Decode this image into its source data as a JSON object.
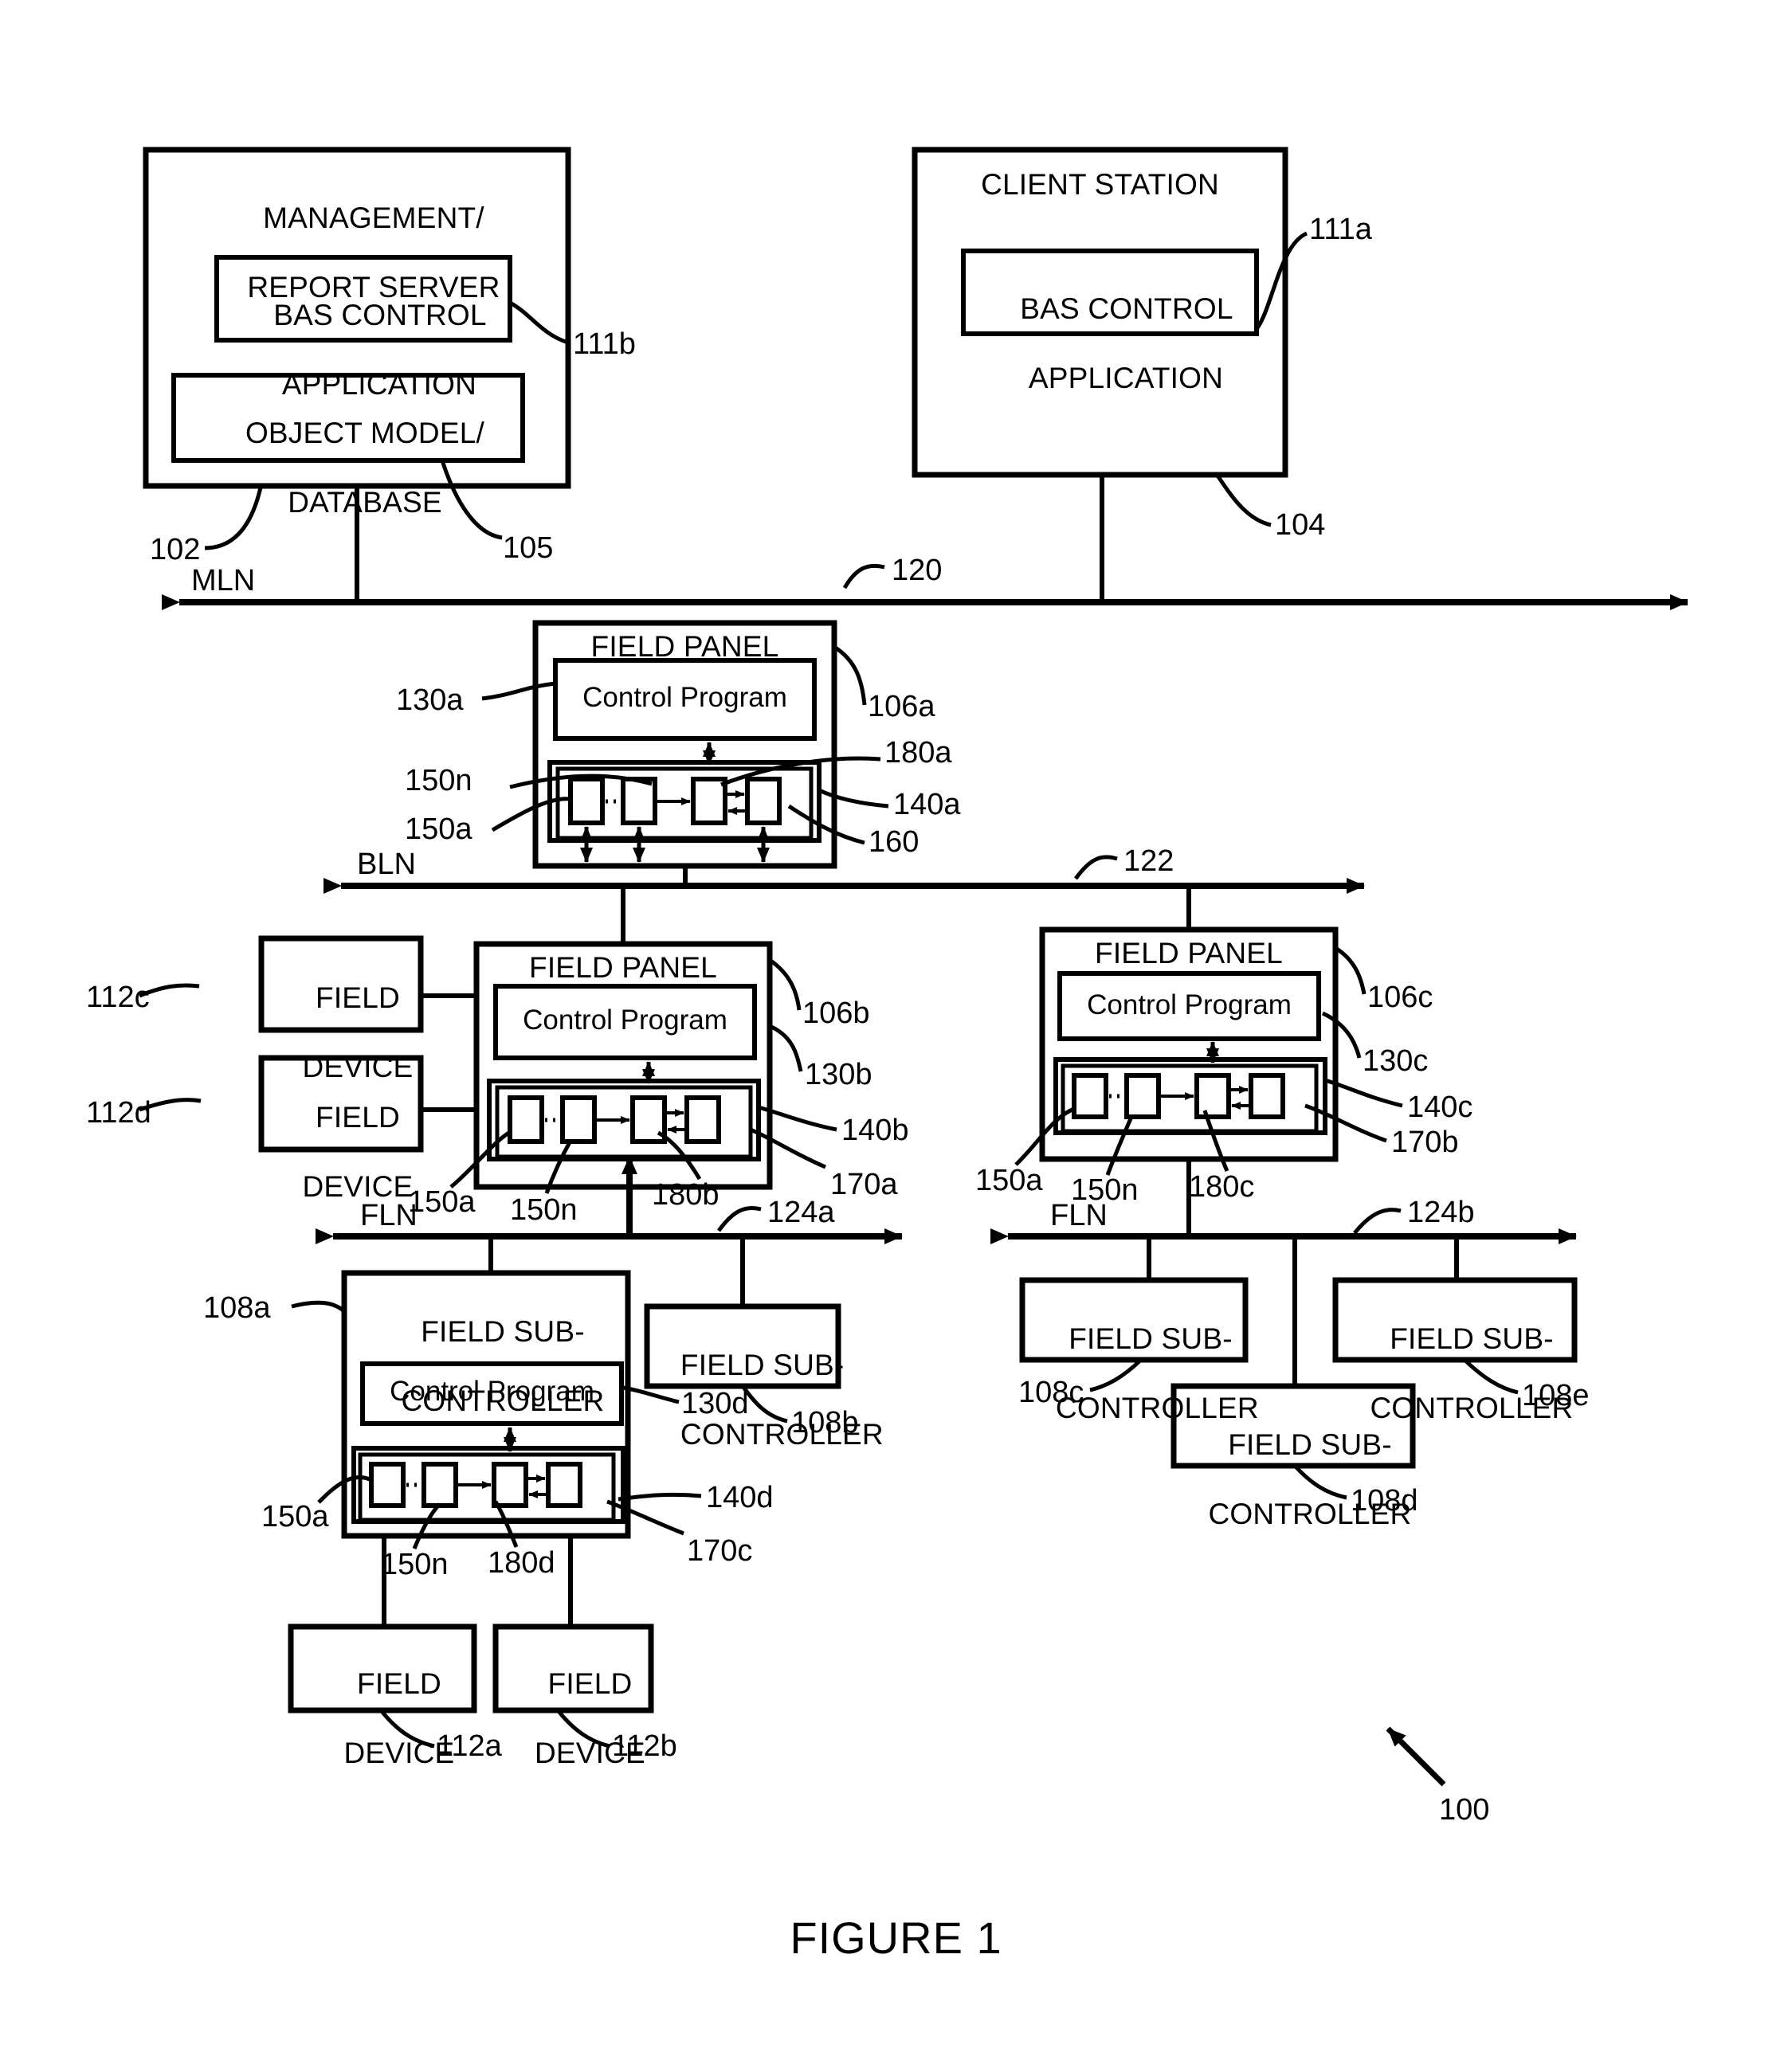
{
  "figure": {
    "caption": "FIGURE 1",
    "system_ref": "100"
  },
  "nodes": {
    "management_server": {
      "title_line1": "MANAGEMENT/",
      "title_line2": "REPORT SERVER",
      "ref": "102",
      "children": [
        {
          "label_line1": "BAS CONTROL",
          "label_line2": "APPLICATION",
          "ref": "111b"
        },
        {
          "label_line1": "OBJECT MODEL/",
          "label_line2": "DATABASE",
          "ref": "105"
        }
      ]
    },
    "client_station": {
      "title": "CLIENT STATION",
      "ref": "104",
      "children": [
        {
          "label_line1": "BAS CONTROL",
          "label_line2": "APPLICATION",
          "ref": "111a"
        }
      ]
    },
    "field_panel_a": {
      "title": "FIELD PANEL",
      "ref": "106a",
      "control_program": "Control Program",
      "control_program_ref": "130a",
      "module_container_ref": "140a",
      "module_inner_ref": "160",
      "module_first_ref": "150a",
      "module_last_ref": "150n",
      "bus_ref": "180a"
    },
    "field_panel_b": {
      "title": "FIELD PANEL",
      "ref": "106b",
      "control_program": "Control Program",
      "control_program_ref": "130b",
      "module_container_ref": "140b",
      "module_inner_ref": "170a",
      "module_first_ref": "150a",
      "module_last_ref": "150n",
      "bus_ref": "180b"
    },
    "field_panel_c": {
      "title": "FIELD PANEL",
      "ref": "106c",
      "control_program": "Control Program",
      "control_program_ref": "130c",
      "module_container_ref": "140c",
      "module_inner_ref": "170b",
      "module_first_ref": "150a",
      "module_last_ref": "150n",
      "bus_ref": "180c"
    },
    "field_sub_controller_a": {
      "title_line1": "FIELD SUB-",
      "title_line2": "CONTROLLER",
      "ref": "108a",
      "control_program": "Control Program",
      "control_program_ref": "130d",
      "module_container_ref": "140d",
      "module_inner_ref": "170c",
      "module_first_ref": "150a",
      "module_last_ref": "150n",
      "bus_ref": "180d"
    },
    "field_sub_controller_b": {
      "title_line1": "FIELD SUB-",
      "title_line2": "CONTROLLER",
      "ref": "108b"
    },
    "field_sub_controller_c": {
      "title_line1": "FIELD SUB-",
      "title_line2": "CONTROLLER",
      "ref": "108c"
    },
    "field_sub_controller_d": {
      "title_line1": "FIELD SUB-",
      "title_line2": "CONTROLLER",
      "ref": "108d"
    },
    "field_sub_controller_e": {
      "title_line1": "FIELD SUB-",
      "title_line2": "CONTROLLER",
      "ref": "108e"
    },
    "field_device_a": {
      "title_line1": "FIELD",
      "title_line2": "DEVICE",
      "ref": "112a"
    },
    "field_device_b": {
      "title_line1": "FIELD",
      "title_line2": "DEVICE",
      "ref": "112b"
    },
    "field_device_c": {
      "title_line1": "FIELD",
      "title_line2": "DEVICE",
      "ref": "112c"
    },
    "field_device_d": {
      "title_line1": "FIELD",
      "title_line2": "DEVICE",
      "ref": "112d"
    }
  },
  "networks": [
    {
      "name": "mln",
      "label": "MLN",
      "ref": "120"
    },
    {
      "name": "bln",
      "label": "BLN",
      "ref": "122"
    },
    {
      "name": "fln_a",
      "label": "FLN",
      "ref": "124a"
    },
    {
      "name": "fln_b",
      "label": "FLN",
      "ref": "124b"
    }
  ],
  "colors": {
    "stroke": "#000000",
    "background": "#ffffff"
  }
}
